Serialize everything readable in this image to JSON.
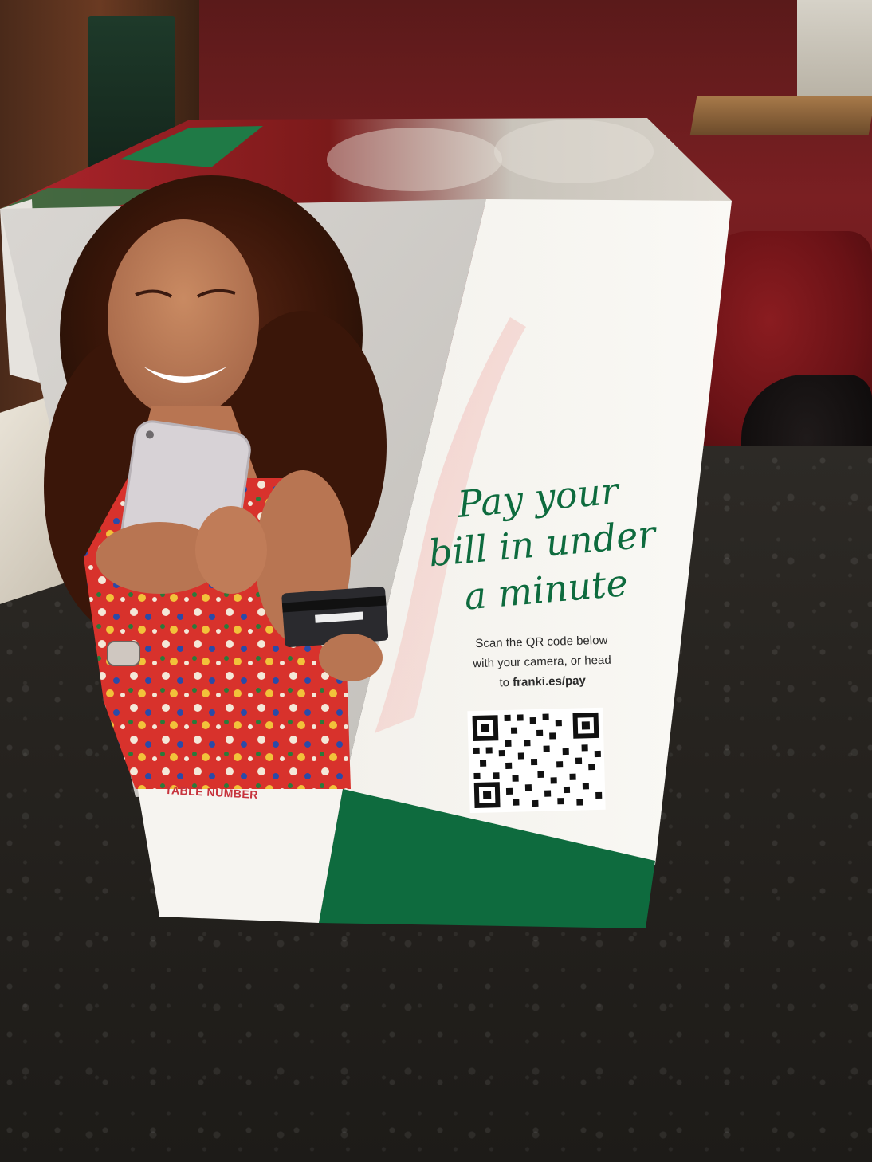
{
  "promo": {
    "headline_lines": [
      "Pay your",
      "bill in under",
      "a minute"
    ],
    "instructions_line1": "Scan the QR code below",
    "instructions_line2": "with your camera, or head",
    "instructions_line3_prefix": "to ",
    "instructions_link": "franki.es/pay",
    "table_label": "TABLE NUMBER"
  },
  "colors": {
    "brand_green": "#0e6b3e",
    "brand_red": "#c7333d",
    "card_white": "#f7f5f1"
  }
}
